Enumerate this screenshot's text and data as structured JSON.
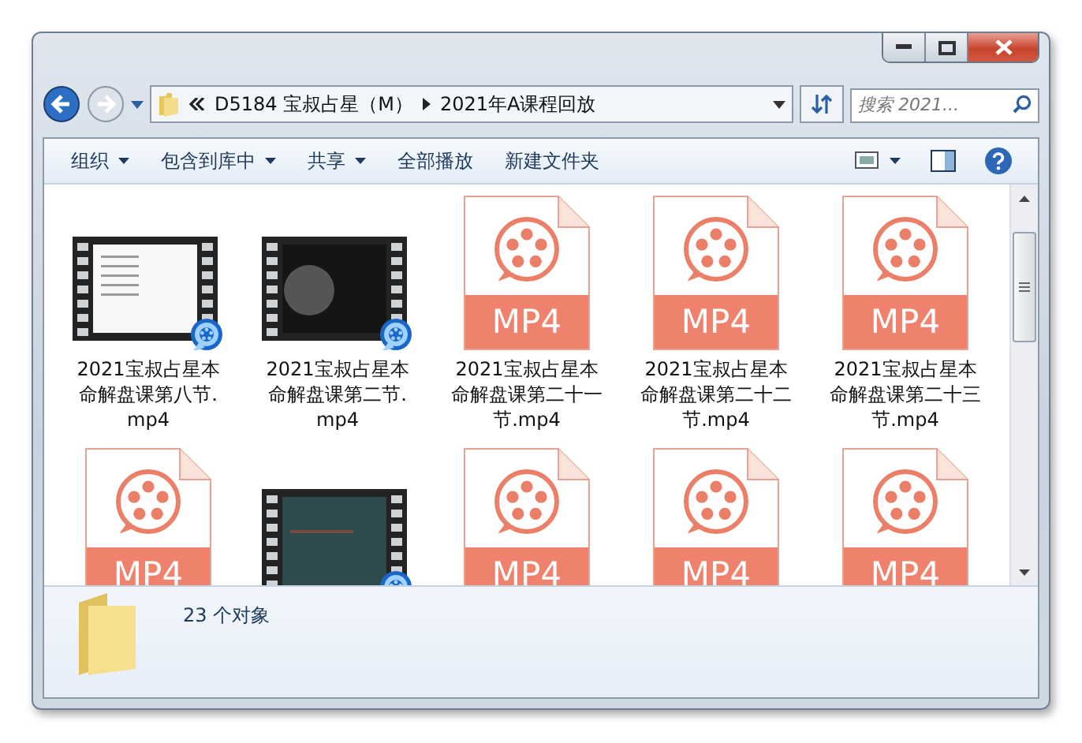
{
  "address": {
    "path": [
      "D5184 宝叔占星（M）",
      "2021年A课程回放"
    ]
  },
  "search": {
    "placeholder": "搜索 2021..."
  },
  "toolbar": {
    "buttons": [
      {
        "label": "组织",
        "dropdown": true
      },
      {
        "label": "包含到库中",
        "dropdown": true
      },
      {
        "label": "共享",
        "dropdown": true
      },
      {
        "label": "全部播放",
        "dropdown": false
      },
      {
        "label": "新建文件夹",
        "dropdown": false
      }
    ]
  },
  "files": [
    {
      "kind": "video",
      "name": "2021宝叔占星本命解盘课第八节.mp4"
    },
    {
      "kind": "video",
      "name": "2021宝叔占星本命解盘课第二节.mp4"
    },
    {
      "kind": "mp4",
      "badge": "MP4",
      "name": "2021宝叔占星本命解盘课第二十一节.mp4"
    },
    {
      "kind": "mp4",
      "badge": "MP4",
      "name": "2021宝叔占星本命解盘课第二十二节.mp4"
    },
    {
      "kind": "mp4",
      "badge": "MP4",
      "name": "2021宝叔占星本命解盘课第二十三节.mp4"
    },
    {
      "kind": "mp4",
      "badge": "MP4"
    },
    {
      "kind": "video"
    },
    {
      "kind": "mp4",
      "badge": "MP4"
    },
    {
      "kind": "mp4",
      "badge": "MP4"
    },
    {
      "kind": "mp4",
      "badge": "MP4"
    }
  ],
  "status_bar": {
    "count": "23 个对象"
  }
}
